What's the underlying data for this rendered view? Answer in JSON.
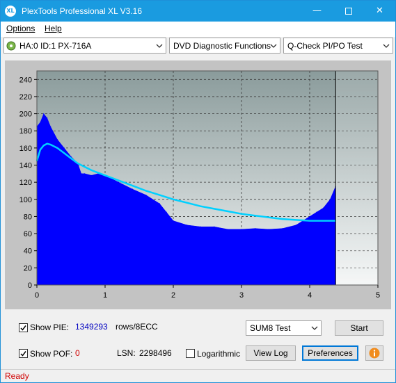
{
  "window": {
    "title": "PlexTools Professional XL V3.16",
    "icon_text": "XL"
  },
  "menu": [
    {
      "label": "Options"
    },
    {
      "label": "Help"
    }
  ],
  "toolbar": {
    "drive": "HA:0 ID:1  PX-716A",
    "function": "DVD Diagnostic Functions",
    "test": "Q-Check PI/PO Test"
  },
  "chart_data": {
    "type": "area",
    "xlim": [
      0,
      5
    ],
    "ylim": [
      0,
      250
    ],
    "xticks": [
      "0",
      "1",
      "2",
      "3",
      "4",
      "5"
    ],
    "yticks": [
      "0",
      "20",
      "40",
      "60",
      "80",
      "100",
      "120",
      "140",
      "160",
      "180",
      "200",
      "220",
      "240"
    ],
    "grid": true,
    "end_marker_x": 4.38,
    "series": [
      {
        "type": "area",
        "color": "#0000ff",
        "x": [
          0.0,
          0.05,
          0.1,
          0.15,
          0.2,
          0.3,
          0.4,
          0.5,
          0.6,
          0.65,
          0.7,
          0.8,
          0.9,
          1.0,
          1.2,
          1.4,
          1.6,
          1.8,
          1.9,
          2.0,
          2.2,
          2.4,
          2.6,
          2.8,
          3.0,
          3.2,
          3.4,
          3.6,
          3.8,
          3.9,
          4.0,
          4.1,
          4.2,
          4.3,
          4.38
        ],
        "values": [
          185,
          190,
          200,
          195,
          185,
          170,
          160,
          150,
          142,
          130,
          130,
          128,
          130,
          128,
          120,
          112,
          105,
          95,
          85,
          75,
          70,
          68,
          68,
          65,
          65,
          66,
          65,
          66,
          70,
          75,
          80,
          85,
          90,
          100,
          115
        ]
      },
      {
        "type": "line",
        "color": "#00d0ff",
        "x": [
          0.0,
          0.05,
          0.1,
          0.15,
          0.2,
          0.3,
          0.4,
          0.5,
          0.6,
          0.8,
          1.0,
          1.2,
          1.4,
          1.6,
          1.8,
          2.0,
          2.2,
          2.4,
          2.6,
          2.8,
          3.0,
          3.2,
          3.4,
          3.6,
          3.8,
          4.0,
          4.2,
          4.38
        ],
        "values": [
          145,
          158,
          163,
          165,
          164,
          160,
          154,
          148,
          142,
          134,
          128,
          122,
          116,
          110,
          105,
          100,
          96,
          92,
          89,
          86,
          83,
          81,
          79,
          77,
          76,
          75,
          75,
          75
        ]
      }
    ]
  },
  "bottom": {
    "show_pie_label": "Show PIE:",
    "show_pie_checked": true,
    "pie_value": "1349293",
    "pie_unit": "rows/8ECC",
    "show_pof_label": "Show POF:",
    "show_pof_checked": true,
    "pof_value": "0",
    "lsn_label": "LSN:",
    "lsn_value": "2298496",
    "logarithmic_label": "Logarithmic",
    "logarithmic_checked": false,
    "sum_select": "SUM8 Test",
    "start_label": "Start",
    "view_log_label": "View Log",
    "preferences_label": "Preferences"
  },
  "status": {
    "text": "Ready"
  },
  "colors": {
    "titlebar": "#1a9be0",
    "pie_value": "#0000c0",
    "pof_value": "#d00000",
    "status": "#d00000"
  }
}
